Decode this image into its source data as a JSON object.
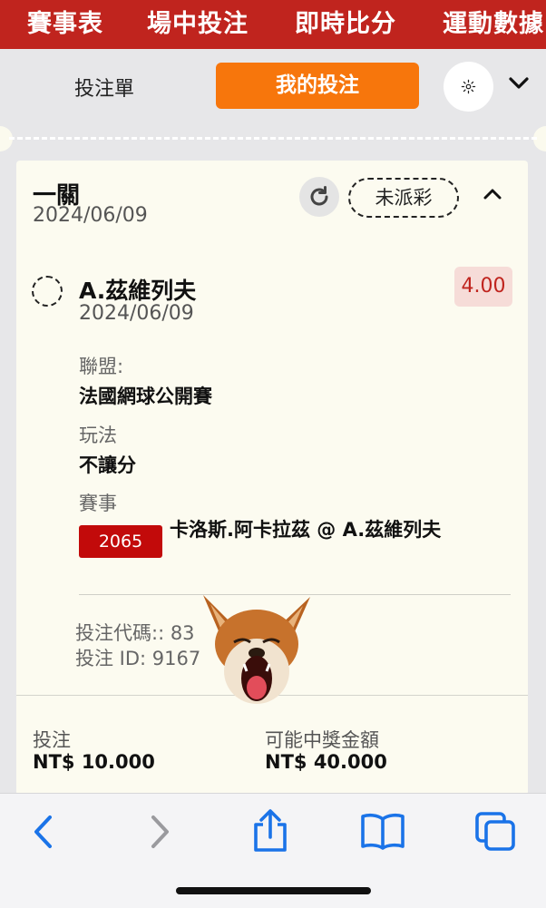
{
  "nav": {
    "items": [
      "賽事表",
      "場中投注",
      "即時比分",
      "運動數據"
    ]
  },
  "betslip": {
    "tab_label": "投注單",
    "mybets_label": "我的投注",
    "gear_icon": "gear-icon",
    "collapse_icon": "chevron-down-icon"
  },
  "bet": {
    "type": "一關",
    "date": "2024/06/09",
    "status": "未派彩",
    "selection": {
      "name": "A.茲維列夫",
      "date": "2024/06/09",
      "odds": "4.00"
    },
    "league_label": "聯盟:",
    "league": "法國網球公開賽",
    "market_label": "玩法",
    "market": "不讓分",
    "event_label": "賽事",
    "event_id": "2065",
    "event_name": "卡洛斯.阿卡拉茲 @ A.茲維列夫",
    "code_line": "投注代碼:: 83",
    "id_line": "投注 ID: 9167",
    "stake_label": "投注",
    "stake_value": "NT$ 10.000",
    "win_label": "可能中獎金額",
    "win_value": "NT$ 40.000"
  },
  "colors": {
    "brand_red": "#c0241e",
    "accent_orange": "#f7760c",
    "ios_blue": "#1a73e8"
  }
}
